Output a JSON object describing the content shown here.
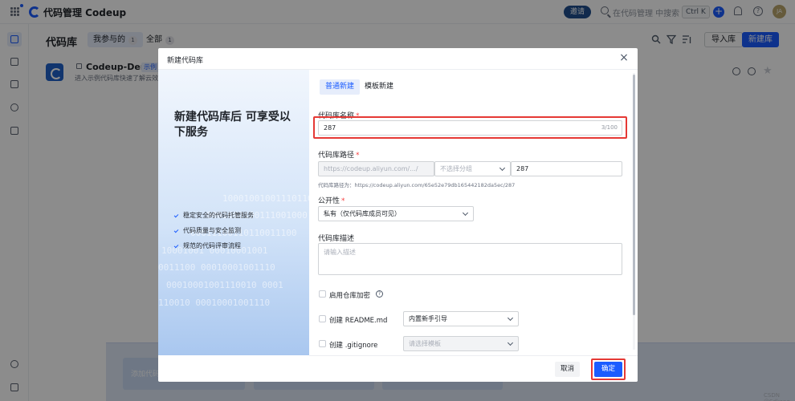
{
  "topbar": {
    "app_title": "代码管理 Codeup",
    "invite_label": "邀请",
    "search_placeholder": "在代码管理 中搜索",
    "search_shortcut": "Ctrl K",
    "plus_label": "+",
    "help_label": "?",
    "user_initials": "JA"
  },
  "page": {
    "title": "代码库",
    "tabs": [
      {
        "label": "我参与的",
        "count": "1"
      },
      {
        "label": "全部",
        "count": "1"
      }
    ],
    "import_label": "导入库",
    "new_label": "新建库"
  },
  "repo": {
    "name": "Codeup-Demo",
    "tag": "示例",
    "desc": "进入示例代码库快速了解云效 Co"
  },
  "bottom": {
    "card_label": "添加代码"
  },
  "watermark": "CSDN @Sdkong",
  "modal": {
    "title": "新建代码库",
    "close_label": "×",
    "promo": {
      "title": "新建代码库后 可享受以下服务",
      "binary_lines": [
        "10001001001110110",
        "0001000100111001000",
        "00011100110110011100",
        "10001001 00010001001",
        "0011100 00010001001110",
        "00010001001110010 0001",
        "110010 00010001001110"
      ],
      "features": [
        "稳定安全的代码托管服务",
        "代码质量与安全监测",
        "规范的代码评审流程"
      ]
    },
    "tabs": [
      "普通新建",
      "模板新建"
    ],
    "name_field": {
      "label": "代码库名称",
      "required": "*",
      "value": "287",
      "counter": "3/100"
    },
    "path_field": {
      "label": "代码库路径",
      "required": "*",
      "prefix": "https://codeup.aliyun.com/.../",
      "group_placeholder": "不选择分组",
      "value": "287",
      "hint": "代码库路径为：https://codeup.aliyun.com/65e52e79db165442182da5ec/287"
    },
    "visibility_field": {
      "label": "公开性",
      "required": "*",
      "value": "私有（仅代码库成员可见）"
    },
    "desc_field": {
      "label": "代码库描述",
      "placeholder": "请输入描述"
    },
    "encrypt_label": "启用仓库加密",
    "encrypt_help": "?",
    "readme": {
      "label": "创建 README.md",
      "select": "内置新手引导"
    },
    "gitignore": {
      "label": "创建 .gitignore",
      "select": "请选择模板"
    },
    "cancel_label": "取消",
    "ok_label": "确定"
  },
  "colors": {
    "accent": "#1b5cff",
    "highlight": "#e53935"
  }
}
